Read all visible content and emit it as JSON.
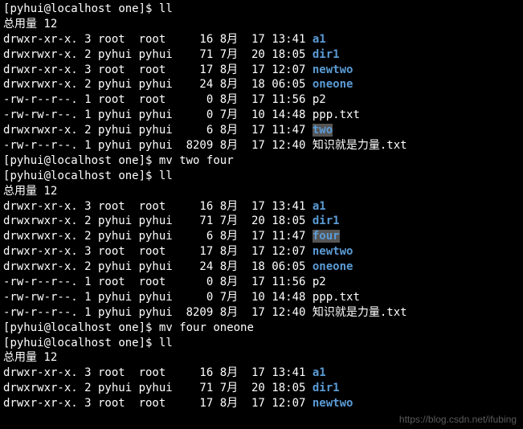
{
  "prompts": {
    "p1": {
      "user_host": "pyhui@localhost",
      "path": "one",
      "cmd": "ll"
    },
    "p2": {
      "user_host": "pyhui@localhost",
      "path": "one",
      "cmd": "mv two four"
    },
    "p3": {
      "user_host": "pyhui@localhost",
      "path": "one",
      "cmd": "ll"
    },
    "p4": {
      "user_host": "pyhui@localhost",
      "path": "one",
      "cmd": "mv four oneone"
    },
    "p5": {
      "user_host": "pyhui@localhost",
      "path": "one",
      "cmd": "ll"
    }
  },
  "totals": {
    "t1": "总用量 12",
    "t2": "总用量 12",
    "t3": "总用量 12"
  },
  "listing1": [
    {
      "perm": "drwxr-xr-x. 3 root  root     16 8月  17 13:41 ",
      "name": "a1",
      "dir": true,
      "hl": false
    },
    {
      "perm": "drwxrwxr-x. 2 pyhui pyhui    71 7月  20 18:05 ",
      "name": "dir1",
      "dir": true,
      "hl": false
    },
    {
      "perm": "drwxr-xr-x. 3 root  root     17 8月  17 12:07 ",
      "name": "newtwo",
      "dir": true,
      "hl": false
    },
    {
      "perm": "drwxrwxr-x. 2 pyhui pyhui    24 8月  18 06:05 ",
      "name": "oneone",
      "dir": true,
      "hl": false
    },
    {
      "perm": "-rw-r--r--. 1 root  root      0 8月  17 11:56 ",
      "name": "p2",
      "dir": false,
      "hl": false
    },
    {
      "perm": "-rw-rw-r--. 1 pyhui pyhui     0 7月  10 14:48 ",
      "name": "ppp.txt",
      "dir": false,
      "hl": false
    },
    {
      "perm": "drwxrwxr-x. 2 pyhui pyhui     6 8月  17 11:47 ",
      "name": "two",
      "dir": true,
      "hl": true
    },
    {
      "perm": "-rw-r--r--. 1 pyhui pyhui  8209 8月  17 12:40 ",
      "name": "知识就是力量.txt",
      "dir": false,
      "hl": false
    }
  ],
  "listing2": [
    {
      "perm": "drwxr-xr-x. 3 root  root     16 8月  17 13:41 ",
      "name": "a1",
      "dir": true,
      "hl": false
    },
    {
      "perm": "drwxrwxr-x. 2 pyhui pyhui    71 7月  20 18:05 ",
      "name": "dir1",
      "dir": true,
      "hl": false
    },
    {
      "perm": "drwxrwxr-x. 2 pyhui pyhui     6 8月  17 11:47 ",
      "name": "four",
      "dir": true,
      "hl": true
    },
    {
      "perm": "drwxr-xr-x. 3 root  root     17 8月  17 12:07 ",
      "name": "newtwo",
      "dir": true,
      "hl": false
    },
    {
      "perm": "drwxrwxr-x. 2 pyhui pyhui    24 8月  18 06:05 ",
      "name": "oneone",
      "dir": true,
      "hl": false
    },
    {
      "perm": "-rw-r--r--. 1 root  root      0 8月  17 11:56 ",
      "name": "p2",
      "dir": false,
      "hl": false
    },
    {
      "perm": "-rw-rw-r--. 1 pyhui pyhui     0 7月  10 14:48 ",
      "name": "ppp.txt",
      "dir": false,
      "hl": false
    },
    {
      "perm": "-rw-r--r--. 1 pyhui pyhui  8209 8月  17 12:40 ",
      "name": "知识就是力量.txt",
      "dir": false,
      "hl": false
    }
  ],
  "listing3": [
    {
      "perm": "drwxr-xr-x. 3 root  root     16 8月  17 13:41 ",
      "name": "a1",
      "dir": true,
      "hl": false
    },
    {
      "perm": "drwxrwxr-x. 2 pyhui pyhui    71 7月  20 18:05 ",
      "name": "dir1",
      "dir": true,
      "hl": false
    },
    {
      "perm": "drwxr-xr-x. 3 root  root     17 8月  17 12:07 ",
      "name": "newtwo",
      "dir": true,
      "hl": false
    }
  ],
  "watermark": "https://blog.csdn.net/ifubing"
}
